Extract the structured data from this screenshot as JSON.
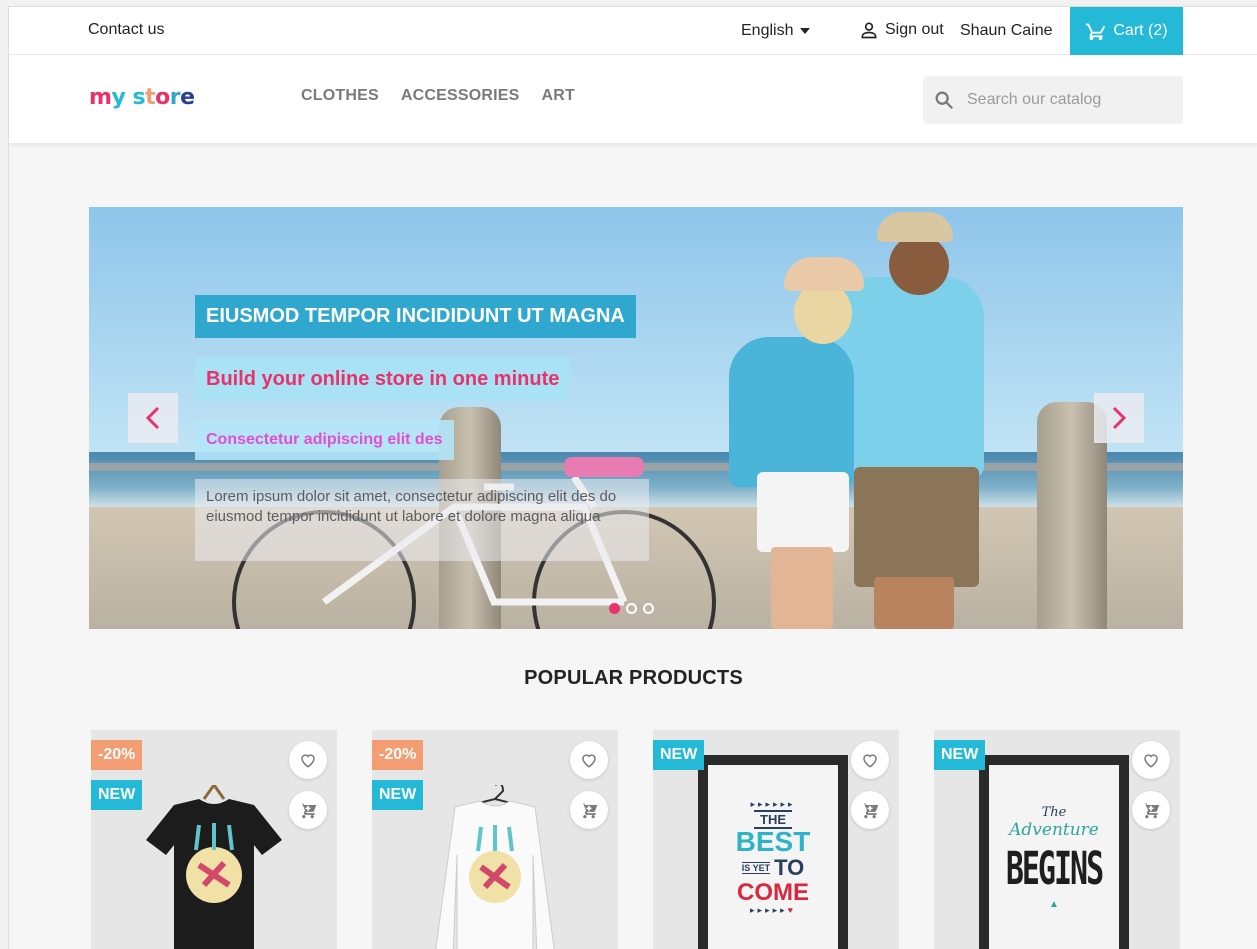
{
  "topnav": {
    "contact": "Contact us",
    "language": "English",
    "signout": "Sign out",
    "username": "Shaun Caine",
    "cart": "Cart (2)"
  },
  "header": {
    "logo_parts": [
      "m",
      "y",
      " ",
      "s",
      "t",
      "o",
      "r",
      "e"
    ],
    "logo_colors": [
      "#e8326b",
      "#24b9d7",
      "",
      "#24b9d7",
      "#f39d72",
      "#e8326b",
      "#2fa7cf",
      "#2a3f8f"
    ],
    "menu": [
      "CLOTHES",
      "ACCESSORIES",
      "ART"
    ],
    "search_placeholder": "Search our catalog"
  },
  "slider": {
    "title": "EIUSMOD TEMPOR INCIDIDUNT UT MAGNA",
    "subtitle": "Build your online store in one minute",
    "tagline": "Consectetur adipiscing elit des",
    "body": "Lorem ipsum dolor sit amet, consectetur adipiscing elit des do eiusmod tempor incididunt ut labore et dolore magna aliqua",
    "dots": 3,
    "active_dot": 0
  },
  "popular": {
    "title": "POPULAR PRODUCTS",
    "products": [
      {
        "discount": "-20%",
        "new": "NEW",
        "type": "black-tshirt"
      },
      {
        "discount": "-20%",
        "new": "NEW",
        "type": "white-longsleeve"
      },
      {
        "discount": "",
        "new": "NEW",
        "type": "poster-best-is-yet-to-come"
      },
      {
        "discount": "",
        "new": "NEW",
        "type": "poster-adventure-begins"
      }
    ],
    "poster1_lines": [
      "THE",
      "BEST",
      "IS YET",
      "TO",
      "COME"
    ],
    "poster2_lines": [
      "The",
      "Adventure",
      "BEGINS"
    ]
  },
  "colors": {
    "accent": "#24b9d7",
    "discount": "#f39d72",
    "pink": "#e8326b"
  }
}
